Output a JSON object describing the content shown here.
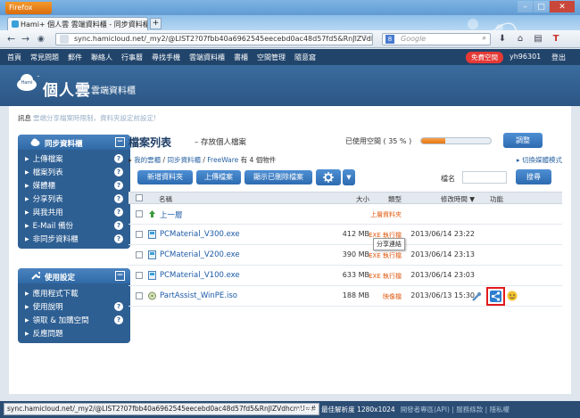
{
  "browser": {
    "app_button": "Firefox",
    "tab_title": "Hami+ 個人雲 雲端資料櫃 - 同步資料櫃...",
    "new_tab": "+",
    "url": "sync.hamicloud.net/_my2/@LIST2?07fbb40a6962545eecebd0ac48d57fd5&RnJlZVdhc",
    "search_engine": "8",
    "search_placeholder": "Google"
  },
  "site_nav": {
    "links": [
      "首頁",
      "常見問題",
      "郵件",
      "聯絡人",
      "行事曆",
      "尋找手機",
      "雲端資料櫃",
      "書櫃",
      "空間管理",
      "隨意窩"
    ],
    "free_space": "免費空間",
    "username": "yh96301",
    "logout": "登出"
  },
  "header": {
    "logo": "個人雲",
    "subtitle": "雲端資料櫃",
    "logo_badge": "Hami"
  },
  "notice": {
    "label": "訊息",
    "message": "雲端分享檔案時限制，資料夾設定前設定!"
  },
  "sidebar": {
    "sync": {
      "title": "同步資料櫃",
      "items": [
        {
          "label": "上傳檔案",
          "help": "?"
        },
        {
          "label": "檔案列表",
          "help": "?"
        },
        {
          "label": "媒體櫃",
          "help": "?"
        },
        {
          "label": "分享列表",
          "help": "?"
        },
        {
          "label": "與我共用",
          "help": "?"
        },
        {
          "label": "E-Mail 備份",
          "help": "?"
        },
        {
          "label": "非同步資料櫃",
          "help": "?"
        }
      ]
    },
    "settings": {
      "title": "使用設定",
      "items": [
        {
          "label": "應用程式下載",
          "help": ""
        },
        {
          "label": "使用說明",
          "help": "?"
        },
        {
          "label": "領取 & 加購空間",
          "help": "?"
        },
        {
          "label": "反應問題",
          "help": ""
        }
      ]
    }
  },
  "main": {
    "title": "檔案列表",
    "title_sub": "存放個人檔案",
    "usage_label": "已使用空間 ( 35 % )",
    "usage_percent": 35,
    "adjust_button": "調整",
    "breadcrumb": [
      "我的雲櫃",
      "同步資料櫃",
      "FreeWare"
    ],
    "breadcrumb_count": "有 4 個物件",
    "switch_mode": "切換媒體模式",
    "new_folder": "新增資料夾",
    "upload": "上傳檔案",
    "show_deleted": "顯示已刪除檔案",
    "filename_label": "檔名",
    "search_button": "搜尋",
    "columns": {
      "name": "名稱",
      "size": "大小",
      "type": "類型",
      "modified": "修改時間 ▼",
      "actions": "功能"
    },
    "rows": [
      {
        "name": "上一層",
        "size": "",
        "type": "上層資料夾",
        "modified": ""
      },
      {
        "name": "PCMaterial_V300.exe",
        "size": "412 MB",
        "type": "EXE 執行檔",
        "modified": "2013/06/14 23:22"
      },
      {
        "name": "PCMaterial_V200.exe",
        "size": "390 MB",
        "type": "EXE 執行檔",
        "modified": "2013/06/14 23:13"
      },
      {
        "name": "PCMaterial_V100.exe",
        "size": "633 MB",
        "type": "EXE 執行檔",
        "modified": "2013/06/14 23:03"
      },
      {
        "name": "PartAssist_WinPE.iso",
        "size": "188 MB",
        "type": "映像檔",
        "modified": "2013/06/13 15:30"
      }
    ],
    "tooltip": "分享連結"
  },
  "status": {
    "link_preview": "sync.hamicloud.net/_my2/@LIST2?07fbb40a6962545eecebd0ac48d57fd5&RnJlZVdhcmU=#",
    "footer": "served. 最佳解析度 1280x1024",
    "footer_links": "開發者專區(API) | 服務條款 | 隱私權"
  },
  "colors": {
    "accent": "#2e5f93",
    "nav": "#21446b",
    "progress": "#e67612",
    "highlight": "#e21b1b"
  }
}
